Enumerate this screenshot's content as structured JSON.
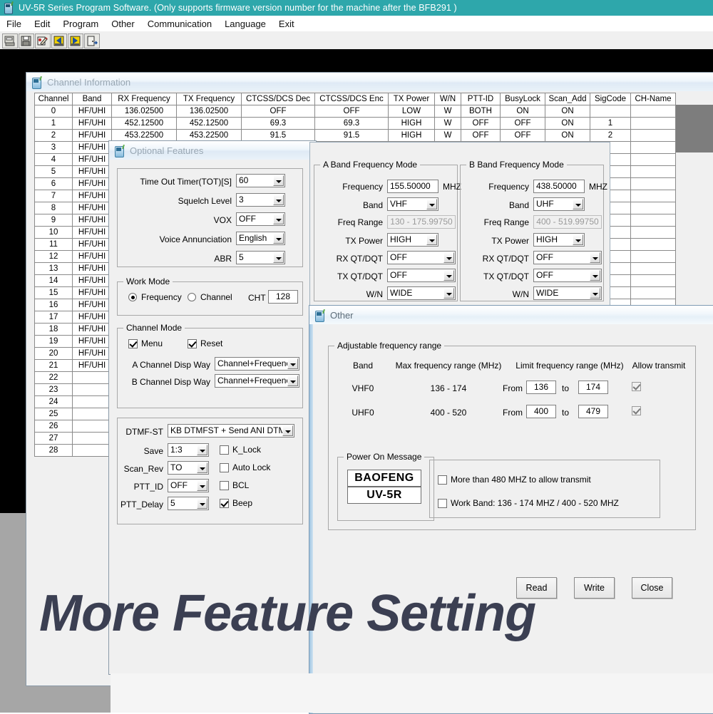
{
  "app": {
    "title": "UV-5R Series Program Software. (Only supports firmware version number for the machine after the BFB291 )",
    "menu": [
      "File",
      "Edit",
      "Program",
      "Other",
      "Communication",
      "Language",
      "Exit"
    ],
    "toolbar_icons": [
      "open-icon",
      "save-icon",
      "edit-icon",
      "read-from-radio-icon",
      "write-to-radio-icon",
      "exit-icon"
    ]
  },
  "watermark": "More Feature Setting",
  "channel_window": {
    "title": "Channel Information",
    "columns": [
      "Channel",
      "Band",
      "RX Frequency",
      "TX Frequency",
      "CTCSS/DCS Dec",
      "CTCSS/DCS Enc",
      "TX Power",
      "W/N",
      "PTT-ID",
      "BusyLock",
      "Scan_Add",
      "SigCode",
      "CH-Name"
    ],
    "rows": [
      {
        "channel": "0",
        "band": "HF/UHI",
        "rx": "136.02500",
        "tx": "136.02500",
        "dec": "OFF",
        "enc": "OFF",
        "power": "LOW",
        "wn": "W",
        "ptt": "BOTH",
        "busy": "ON",
        "scan": "ON",
        "sig": "",
        "name": ""
      },
      {
        "channel": "1",
        "band": "HF/UHI",
        "rx": "452.12500",
        "tx": "452.12500",
        "dec": "69.3",
        "enc": "69.3",
        "power": "HIGH",
        "wn": "W",
        "ptt": "OFF",
        "busy": "OFF",
        "scan": "ON",
        "sig": "1",
        "name": ""
      },
      {
        "channel": "2",
        "band": "HF/UHI",
        "rx": "453.22500",
        "tx": "453.22500",
        "dec": "91.5",
        "enc": "91.5",
        "power": "HIGH",
        "wn": "W",
        "ptt": "OFF",
        "busy": "OFF",
        "scan": "ON",
        "sig": "2",
        "name": ""
      }
    ],
    "short_rows": [
      {
        "channel": "3",
        "band": "HF/UHI"
      },
      {
        "channel": "4",
        "band": "HF/UHI"
      },
      {
        "channel": "5",
        "band": "HF/UHI"
      },
      {
        "channel": "6",
        "band": "HF/UHI"
      },
      {
        "channel": "7",
        "band": "HF/UHI"
      },
      {
        "channel": "8",
        "band": "HF/UHI"
      },
      {
        "channel": "9",
        "band": "HF/UHI"
      },
      {
        "channel": "10",
        "band": "HF/UHI"
      },
      {
        "channel": "11",
        "band": "HF/UHI"
      },
      {
        "channel": "12",
        "band": "HF/UHI"
      },
      {
        "channel": "13",
        "band": "HF/UHI"
      },
      {
        "channel": "14",
        "band": "HF/UHI"
      },
      {
        "channel": "15",
        "band": "HF/UHI"
      },
      {
        "channel": "16",
        "band": "HF/UHI"
      },
      {
        "channel": "17",
        "band": "HF/UHI"
      },
      {
        "channel": "18",
        "band": "HF/UHI"
      },
      {
        "channel": "19",
        "band": "HF/UHI"
      },
      {
        "channel": "20",
        "band": "HF/UHI"
      },
      {
        "channel": "21",
        "band": "HF/UHI"
      },
      {
        "channel": "22",
        "band": ""
      },
      {
        "channel": "23",
        "band": ""
      },
      {
        "channel": "24",
        "band": ""
      },
      {
        "channel": "25",
        "band": ""
      },
      {
        "channel": "26",
        "band": ""
      },
      {
        "channel": "27",
        "band": ""
      },
      {
        "channel": "28",
        "band": ""
      }
    ]
  },
  "optional_window": {
    "title": "Optional Features",
    "settings": {
      "tot_label": "Time Out Timer(TOT)[S]",
      "tot_value": "60",
      "squelch_label": "Squelch Level",
      "squelch_value": "3",
      "vox_label": "VOX",
      "vox_value": "OFF",
      "voice_label": "Voice Annunciation",
      "voice_value": "English",
      "abr_label": "ABR",
      "abr_value": "5"
    },
    "work_mode": {
      "title": "Work Mode",
      "frequency_label": "Frequency",
      "channel_label": "Channel",
      "selected": "Frequency",
      "cht_label": "CHT",
      "cht_value": "128"
    },
    "channel_mode": {
      "title": "Channel Mode",
      "menu_label": "Menu",
      "menu_checked": true,
      "reset_label": "Reset",
      "reset_checked": true,
      "a_disp_label": "A Channel Disp Way",
      "a_disp_value": "Channel+Frequency",
      "b_disp_label": "B Channel Disp Way",
      "b_disp_value": "Channel+Frequency"
    },
    "dtmf": {
      "dtmfst_label": "DTMF-ST",
      "dtmfst_value": "KB DTMFST + Send ANI DTM",
      "save_label": "Save",
      "save_value": "1:3",
      "scanrev_label": "Scan_Rev",
      "scanrev_value": "TO",
      "pttid_label": "PTT_ID",
      "pttid_value": "OFF",
      "pttdelay_label": "PTT_Delay",
      "pttdelay_value": "5",
      "klock_label": "K_Lock",
      "klock_checked": false,
      "autolock_label": "Auto Lock",
      "autolock_checked": false,
      "bcl_label": "BCL",
      "bcl_checked": false,
      "beep_label": "Beep",
      "beep_checked": true
    }
  },
  "band_a": {
    "title": "A Band Frequency Mode",
    "frequency_label": "Frequency",
    "frequency_value": "155.50000",
    "unit": "MHZ",
    "band_label": "Band",
    "band_value": "VHF",
    "range_label": "Freq Range",
    "range_value": "130 - 175.99750",
    "power_label": "TX Power",
    "power_value": "HIGH",
    "rxqt_label": "RX QT/DQT",
    "rxqt_value": "OFF",
    "txqt_label": "TX QT/DQT",
    "txqt_value": "OFF",
    "wn_label": "W/N",
    "wn_value": "WIDE"
  },
  "band_b": {
    "title": "B Band Frequency Mode",
    "frequency_label": "Frequency",
    "frequency_value": "438.50000",
    "unit": "MHZ",
    "band_label": "Band",
    "band_value": "UHF",
    "range_label": "Freq Range",
    "range_value": "400 - 519.99750",
    "power_label": "TX Power",
    "power_value": "HIGH",
    "rxqt_label": "RX QT/DQT",
    "rxqt_value": "OFF",
    "txqt_label": "TX QT/DQT",
    "txqt_value": "OFF",
    "wn_label": "W/N",
    "wn_value": "WIDE"
  },
  "other_window": {
    "title": "Other",
    "adjustable": {
      "title": "Adjustable  frequency  range",
      "headers": {
        "band": "Band",
        "max": "Max frequency range (MHz)",
        "limit": "Limit frequency range (MHz)",
        "allow": "Allow transmit"
      },
      "from_label": "From",
      "to_label": "to",
      "rows": [
        {
          "band": "VHF0",
          "max": "136 - 174",
          "from": "136",
          "to": "174",
          "allow": true
        },
        {
          "band": "UHF0",
          "max": "400 - 520",
          "from": "400",
          "to": "479",
          "allow": true
        }
      ]
    },
    "power_on": {
      "title": "Power On Message",
      "line1": "BAOFENG",
      "line2": "UV-5R"
    },
    "options": {
      "opt1_label": "More than 480 MHZ to allow transmit",
      "opt1_checked": false,
      "opt2_label": "Work Band: 136 - 174 MHZ / 400 - 520 MHZ",
      "opt2_checked": false
    },
    "buttons": {
      "read": "Read",
      "write": "Write",
      "close": "Close"
    }
  },
  "colors": {
    "titlebar": "#2ea7ab",
    "window_bg": "#f0f0f0",
    "watermark": "#3b3f52",
    "backdrop": "#000000"
  }
}
